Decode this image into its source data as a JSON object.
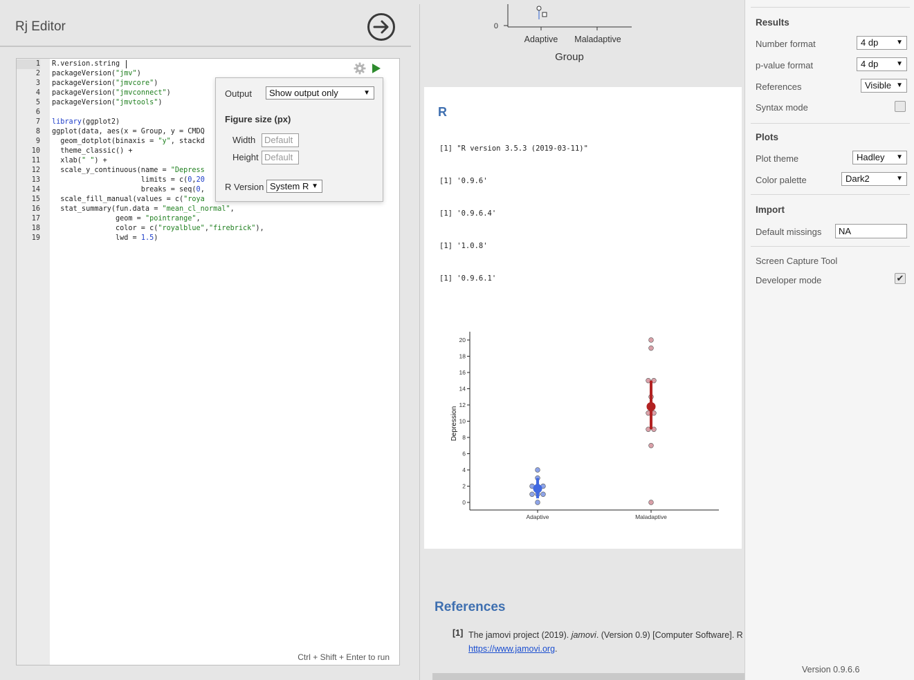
{
  "editor": {
    "title": "Rj Editor",
    "run_hint": "Ctrl + Shift + Enter to run",
    "code_lines": [
      [
        [
          "t",
          "R.version.string"
        ]
      ],
      [
        [
          "t",
          "packageVersion("
        ],
        [
          "s",
          "\"jmv\""
        ],
        [
          "t",
          ")"
        ]
      ],
      [
        [
          "t",
          "packageVersion("
        ],
        [
          "s",
          "\"jmvcore\""
        ],
        [
          "t",
          ")"
        ]
      ],
      [
        [
          "t",
          "packageVersion("
        ],
        [
          "s",
          "\"jmvconnect\""
        ],
        [
          "t",
          ")"
        ]
      ],
      [
        [
          "t",
          "packageVersion("
        ],
        [
          "s",
          "\"jmvtools\""
        ],
        [
          "t",
          ")"
        ]
      ],
      [],
      [
        [
          "k",
          "library"
        ],
        [
          "t",
          "(ggplot2)"
        ]
      ],
      [
        [
          "t",
          "ggplot(data, aes(x = Group, y = CMDQ"
        ]
      ],
      [
        [
          "t",
          "  geom_dotplot(binaxis = "
        ],
        [
          "s",
          "\"y\""
        ],
        [
          "t",
          ", stackd"
        ]
      ],
      [
        [
          "t",
          "  theme_classic() +"
        ]
      ],
      [
        [
          "t",
          "  xlab("
        ],
        [
          "s",
          "\" \""
        ],
        [
          "t",
          ") +"
        ]
      ],
      [
        [
          "t",
          "  scale_y_continuous(name = "
        ],
        [
          "s",
          "\"Depress"
        ]
      ],
      [
        [
          "t",
          "                     limits = c("
        ],
        [
          "n",
          "0"
        ],
        [
          "t",
          ","
        ],
        [
          "n",
          "20"
        ]
      ],
      [
        [
          "t",
          "                     breaks = seq("
        ],
        [
          "n",
          "0"
        ],
        [
          "t",
          ","
        ]
      ],
      [
        [
          "t",
          "  scale_fill_manual(values = c("
        ],
        [
          "s",
          "\"roya"
        ]
      ],
      [
        [
          "t",
          "  stat_summary(fun.data = "
        ],
        [
          "s",
          "\"mean_cl_normal\""
        ],
        [
          "t",
          ","
        ]
      ],
      [
        [
          "t",
          "               geom = "
        ],
        [
          "s",
          "\"pointrange\""
        ],
        [
          "t",
          ","
        ]
      ],
      [
        [
          "t",
          "               color = c("
        ],
        [
          "s",
          "\"royalblue\""
        ],
        [
          "t",
          ","
        ],
        [
          "s",
          "\"firebrick\""
        ],
        [
          "t",
          "),"
        ]
      ],
      [
        [
          "t",
          "               lwd = "
        ],
        [
          "n",
          "1.5"
        ],
        [
          "t",
          ")"
        ]
      ]
    ],
    "line_numbers": [
      "1",
      "2",
      "3",
      "4",
      "5",
      "6",
      "7",
      "8",
      "9",
      "10",
      "11",
      "12",
      "13",
      "14",
      "15",
      "16",
      "17",
      "18",
      "19"
    ]
  },
  "options_popup": {
    "output_label": "Output",
    "output_value": "Show output only",
    "figure_size_heading": "Figure size (px)",
    "width_label": "Width",
    "width_placeholder": "Default",
    "height_label": "Height",
    "height_placeholder": "Default",
    "r_version_label": "R Version",
    "r_version_value": "System R"
  },
  "results": {
    "top_fragment": {
      "y_tick": "0",
      "categories": [
        "Adaptive",
        "Maladaptive"
      ],
      "x_title": "Group"
    },
    "r_heading": "R",
    "outputs": [
      "[1] \"R version 3.5.3 (2019-03-11)\"",
      "[1] '0.9.6'",
      "[1] '0.9.6.4'",
      "[1] '1.0.8'",
      "[1] '0.9.6.1'"
    ],
    "references_heading": "References",
    "reference": {
      "num": "[1]",
      "text_before": "The jamovi project (2019). ",
      "text_italic": "jamovi",
      "text_after": ". (Version 0.9) [Computer Software]. R",
      "link": "https://www.jamovi.org",
      "link_suffix": "."
    }
  },
  "chart_data": {
    "type": "scatter",
    "ylabel": "Depression",
    "xlabel": "",
    "categories": [
      "Adaptive",
      "Maladaptive"
    ],
    "ylim": [
      0,
      21
    ],
    "yticks": [
      0,
      2,
      4,
      6,
      8,
      10,
      12,
      14,
      16,
      18,
      20
    ],
    "series": [
      {
        "category": "Adaptive",
        "points": [
          0,
          1,
          1,
          1,
          2,
          2,
          2,
          3,
          4
        ],
        "mean": 1.7,
        "ci": [
          0.5,
          3.0
        ],
        "fill": "#8ea4e8",
        "summary_color": "#4169e1"
      },
      {
        "category": "Maladaptive",
        "points": [
          0,
          7,
          9,
          9,
          11,
          11,
          12,
          13,
          15,
          15,
          19,
          20
        ],
        "mean": 11.8,
        "ci": [
          9.0,
          15.0
        ],
        "fill": "#d9a0a8",
        "summary_color": "#b22222"
      }
    ]
  },
  "settings": {
    "results_heading": "Results",
    "number_format_label": "Number format",
    "number_format_value": "4 dp",
    "pvalue_format_label": "p-value format",
    "pvalue_format_value": "4 dp",
    "references_label": "References",
    "references_value": "Visible",
    "syntax_mode_label": "Syntax mode",
    "syntax_mode_checked": false,
    "plots_heading": "Plots",
    "plot_theme_label": "Plot theme",
    "plot_theme_value": "Hadley",
    "color_palette_label": "Color palette",
    "color_palette_value": "Dark2",
    "import_heading": "Import",
    "default_missings_label": "Default missings",
    "default_missings_value": "NA",
    "screen_capture_label": "Screen Capture Tool",
    "developer_mode_label": "Developer mode",
    "developer_mode_checked": true,
    "version": "Version 0.9.6.6"
  }
}
